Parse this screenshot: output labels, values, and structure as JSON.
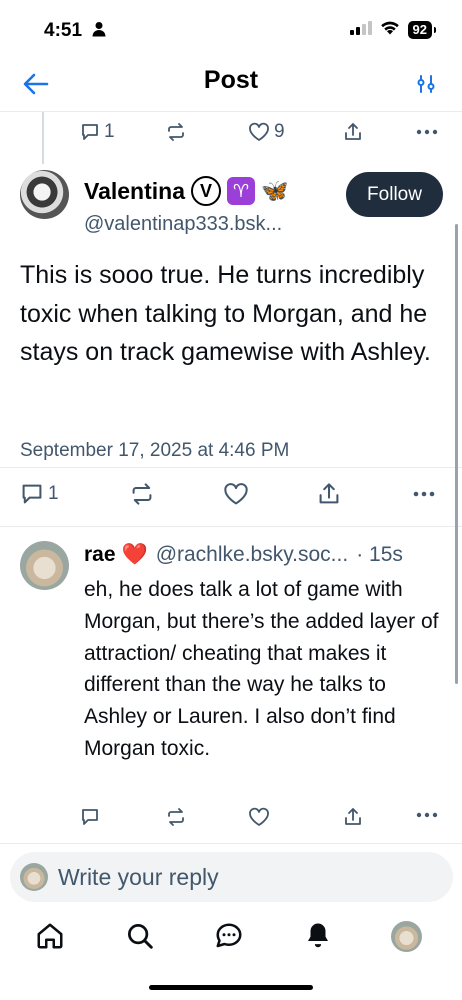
{
  "status_bar": {
    "time": "4:51",
    "battery": "92"
  },
  "nav": {
    "title": "Post"
  },
  "parent_post": {
    "reply_count": "1",
    "like_count": "9"
  },
  "post": {
    "author_name": "Valentina",
    "verified_glyph": "V",
    "zodiac_glyph": "♈",
    "butterfly_glyph": "🦋",
    "author_handle": "@valentinap333.bsk...",
    "follow_label": "Follow",
    "text": "This is sooo true. He turns incredibly toxic when talking to Morgan, and he stays on track gamewise with Ashley.",
    "date": "September 17, 2025 at 4:46 PM",
    "reply_count": "1"
  },
  "reply": {
    "author_name": "rae",
    "heart": "❤️",
    "author_handle": "@rachlke.bsky.soc...",
    "time": "· 15s",
    "text": "eh, he does talk a lot of game with Morgan, but there’s the added layer of attraction/ cheating that makes it different than the way he talks to Ashley or Lauren. I also don’t find Morgan toxic."
  },
  "composer": {
    "placeholder": "Write your reply"
  },
  "colors": {
    "accent_dark": "#1f2d3d",
    "muted": "#42576c",
    "heart": "#e0142a"
  }
}
